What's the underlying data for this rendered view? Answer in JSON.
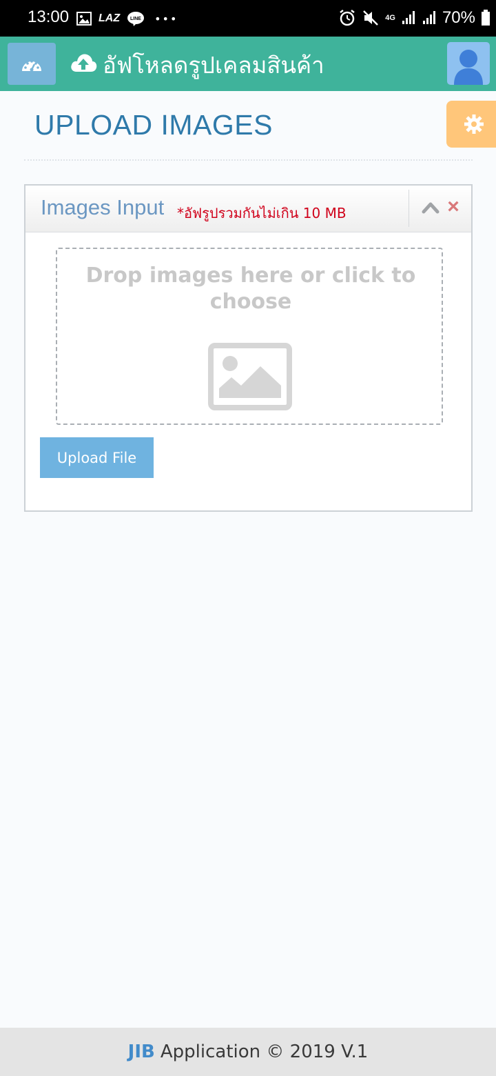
{
  "status_bar": {
    "time": "13:00",
    "notifications": [
      "image-icon",
      "lazada-icon",
      "line-icon",
      "more-dots-icon"
    ],
    "laz_label": "LAZ",
    "line_label": "LINE",
    "more_label": "•••",
    "network": "4G",
    "battery": "70%"
  },
  "header": {
    "title": "อัฟโหลดรูปเคลมสินค้า",
    "icon": "cloud-upload-icon",
    "menu_icon": "dashboard-icon",
    "avatar_icon": "user-icon"
  },
  "page": {
    "title": "UPLOAD IMAGES",
    "settings_icon": "gear-icon"
  },
  "widget": {
    "title": "Images Input",
    "note": "*อัฟรูปรวมกันไม่เกิน 10 MB",
    "collapse_icon": "chevron-up-icon",
    "close_label": "×"
  },
  "dropzone": {
    "text": "Drop images here or click to choose",
    "icon": "image-placeholder-icon"
  },
  "actions": {
    "upload_label": "Upload File"
  },
  "footer": {
    "brand": "JIB",
    "text": "Application © 2019 V.1"
  },
  "colors": {
    "header_bg": "#3fb39b",
    "title_color": "#2f7aaa",
    "note_color": "#d0021b",
    "button_bg": "#6fb3e0",
    "settings_bg": "#ffc67a"
  }
}
